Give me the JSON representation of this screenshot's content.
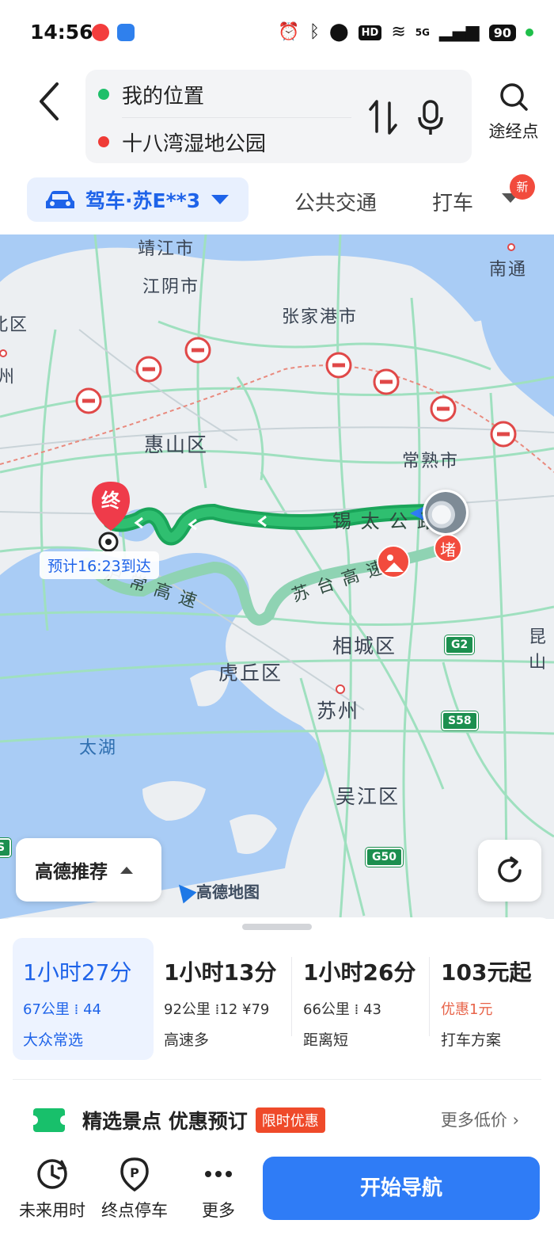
{
  "status_bar": {
    "time": "14:56",
    "hd": "HD",
    "net": "5G",
    "battery": "90"
  },
  "search": {
    "origin": "我的位置",
    "destination": "十八湾湿地公园",
    "via_label": "途经点",
    "icons": {
      "back": "chevron-left-icon",
      "swap": "swap-icon",
      "mic": "mic-icon",
      "via": "search-icon"
    }
  },
  "modes": {
    "drive": "驾车·苏E**3",
    "transit": "公共交通",
    "taxi": "打车",
    "new_badge": "新"
  },
  "map": {
    "labels": {
      "jingjiang": "靖江市",
      "jiangyin": "江阴市",
      "nantong": "南通",
      "zhangjiagang": "张家港市",
      "left_qu": "北区",
      "left_zhou": "州",
      "huishan": "惠山区",
      "changshu": "常熟市",
      "xitai": "锡 太 公 路",
      "huchang": "沪 常 高 速",
      "sutai": "苏 台 高 速",
      "xiangcheng": "相城区",
      "huqiu": "虎丘区",
      "suzhou": "苏州",
      "taihu": "太湖",
      "wujiang": "吴江区",
      "kunshan": "昆山"
    },
    "shields": {
      "g2": "G2",
      "s58": "S58",
      "g50": "G50",
      "s_left": "S"
    },
    "destination_marker": "终",
    "eta": "预计16:23到达",
    "jam_badge": "堵",
    "recommend_button": "高德推荐",
    "logo_text": "高德地图",
    "colors": {
      "route_main": "#1aa55a",
      "route_alt": "#8fd3b3",
      "water": "#a9ccf5",
      "accent": "#1e63e9"
    }
  },
  "route_options": [
    {
      "time": "1小时27分",
      "distance": "67公里",
      "lights": "44",
      "toll": "",
      "tag": "大众常选",
      "selected": true
    },
    {
      "time": "1小时13分",
      "distance": "92公里",
      "lights": "12",
      "toll": "¥79",
      "tag": "高速多",
      "selected": false
    },
    {
      "time": "1小时26分",
      "distance": "66公里",
      "lights": "43",
      "toll": "",
      "tag": "距离短",
      "selected": false
    },
    {
      "time": "103元起",
      "promo": "优惠1元",
      "tag": "打车方案",
      "selected": false
    }
  ],
  "promo": {
    "title": "精选景点 优惠预订",
    "badge": "限时优惠",
    "more": "更多低价 ›"
  },
  "bottom_bar": {
    "future": "未来用时",
    "parking": "终点停车",
    "more": "更多",
    "start": "开始导航"
  }
}
